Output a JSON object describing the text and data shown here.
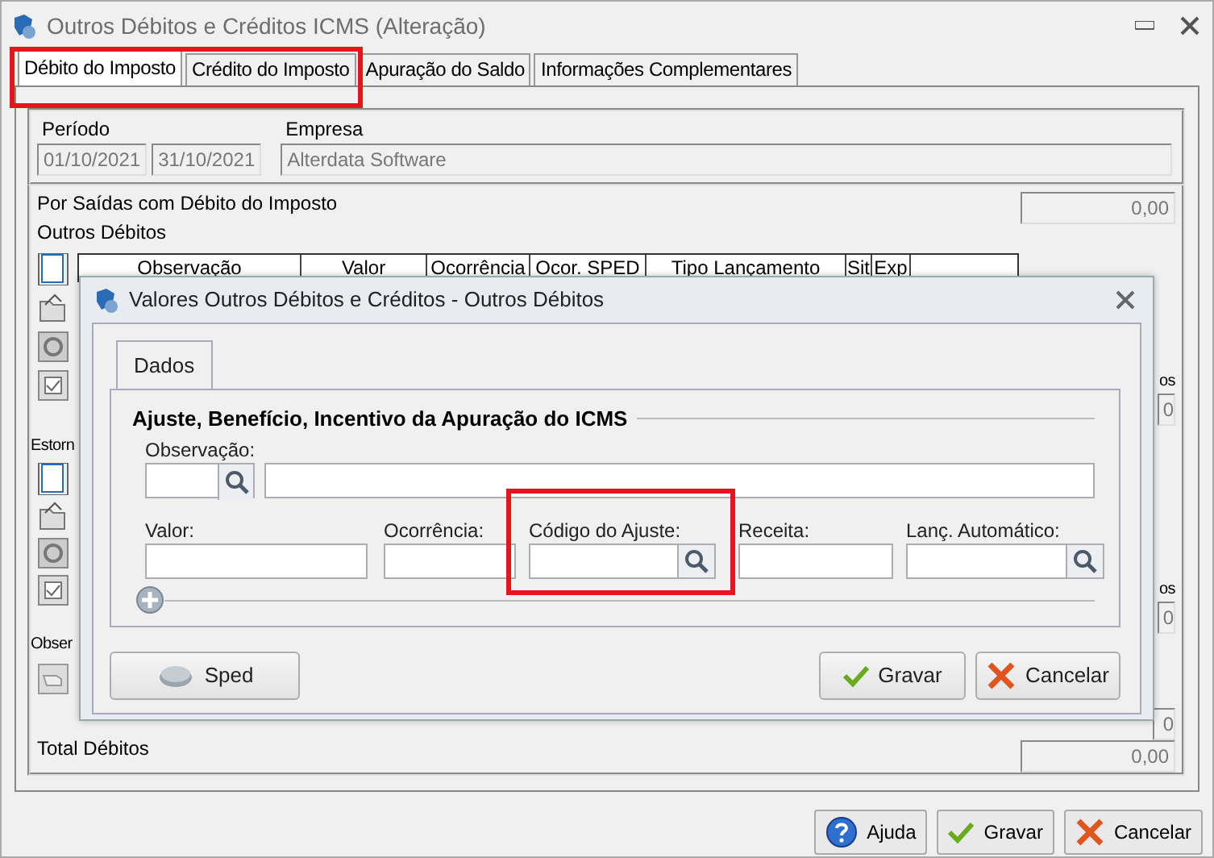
{
  "window": {
    "title": "Outros Débitos e Créditos ICMS (Alteração)"
  },
  "tabs": [
    {
      "label": "Débito do Imposto",
      "selected": true
    },
    {
      "label": "Crédito do Imposto",
      "selected": false
    },
    {
      "label": "Apuração do Saldo",
      "selected": false
    },
    {
      "label": "Informações Complementares",
      "selected": false
    }
  ],
  "periodo": {
    "label": "Período",
    "start": "01/10/2021",
    "end": "31/10/2021"
  },
  "empresa": {
    "label": "Empresa",
    "value": "Alterdata Software"
  },
  "debitos": {
    "section_label": "Por Saídas com Débito do Imposto",
    "section_total": "0,00",
    "list_label": "Outros Débitos",
    "columns": [
      "Observação",
      "Valor",
      "Ocorrência",
      "Ocor. SPED",
      "Tipo Lançamento",
      "Sit",
      "Exp"
    ],
    "estorno_label": "Estorn",
    "observacao_label": "Obser",
    "right_fragments": [
      {
        "label": "os",
        "value": "0"
      },
      {
        "label": "os",
        "value": "0"
      }
    ],
    "bottom_value": "0"
  },
  "total": {
    "label": "Total Débitos",
    "value": "0,00"
  },
  "buttons": [
    {
      "kind": "help",
      "label": "Ajuda"
    },
    {
      "kind": "save",
      "label": "Gravar"
    },
    {
      "kind": "cancel",
      "label": "Cancelar"
    }
  ],
  "dialog": {
    "title": "Valores Outros Débitos e Créditos - Outros Débitos",
    "tabs": [
      {
        "label": "Dados",
        "selected": true
      }
    ],
    "group_title": "Ajuste, Benefício, Incentivo da Apuração do ICMS",
    "observacao_label": "Observação:",
    "fields": [
      {
        "label": "Valor:",
        "lookup": false
      },
      {
        "label": "Ocorrência:",
        "lookup": false
      },
      {
        "label": "Código do Ajuste:",
        "lookup": true
      },
      {
        "label": "Receita:",
        "lookup": false
      },
      {
        "label": "Lanç. Automático:",
        "lookup": true
      }
    ],
    "buttons": [
      {
        "kind": "sped",
        "label": "Sped"
      },
      {
        "kind": "save",
        "label": "Gravar"
      },
      {
        "kind": "cancel",
        "label": "Cancelar"
      }
    ]
  }
}
